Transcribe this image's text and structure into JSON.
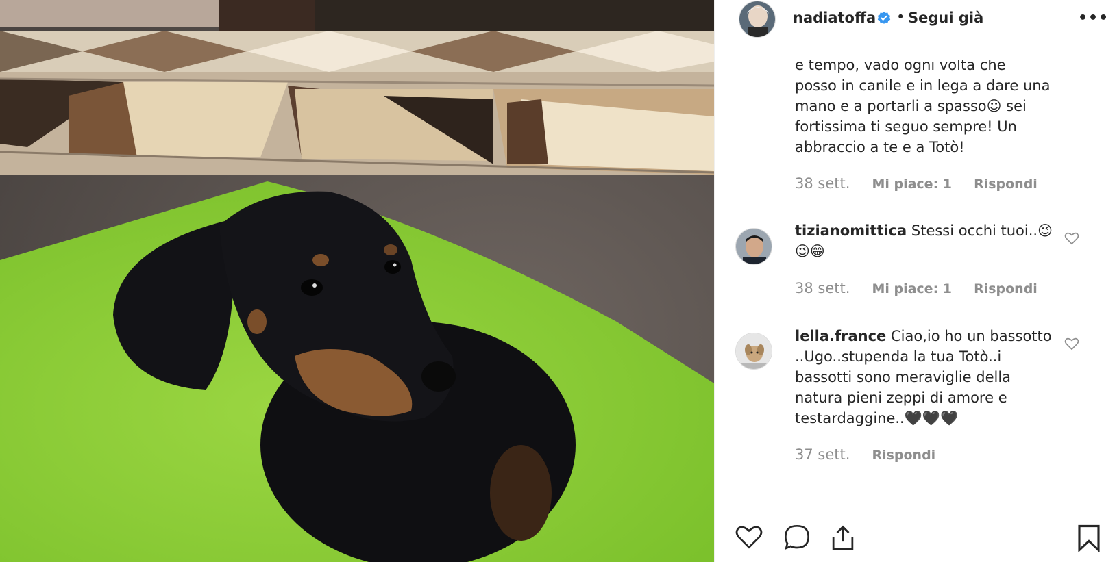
{
  "post": {
    "username": "nadiatoffa",
    "separator": "•",
    "follow_label": "Segui già",
    "more_label": "•••",
    "image_alt": "Black and tan dachshund puppy on a green mat"
  },
  "comments": [
    {
      "lines": [
        "e tempo, vado ogni volta che",
        "posso in canile e in lega a dare una",
        "mano e a portarli a spasso☺ sei",
        "fortissima ti seguo sempre! Un",
        "abbraccio a te e a Totò!"
      ],
      "time": "38 sett.",
      "likes": "Mi piace: 1",
      "reply": "Rispondi"
    },
    {
      "username": "tizianomittica",
      "text_line1": "Stessi occhi tuoi..😉",
      "text_line2": "😉😁",
      "time": "38 sett.",
      "likes": "Mi piace: 1",
      "reply": "Rispondi"
    },
    {
      "username": "lella.france",
      "text_line1": "Ciao,io ho un bassotto",
      "lines": [
        "..Ugo..stupenda la tua Totò..i",
        "bassotti sono meraviglie della",
        "natura pieni zeppi di amore e",
        "testardaggine..🖤🖤🖤"
      ],
      "time": "37 sett.",
      "reply": "Rispondi"
    }
  ],
  "colors": {
    "verified": "#3897f0",
    "muted": "#8e8e8e",
    "text": "#262626"
  }
}
